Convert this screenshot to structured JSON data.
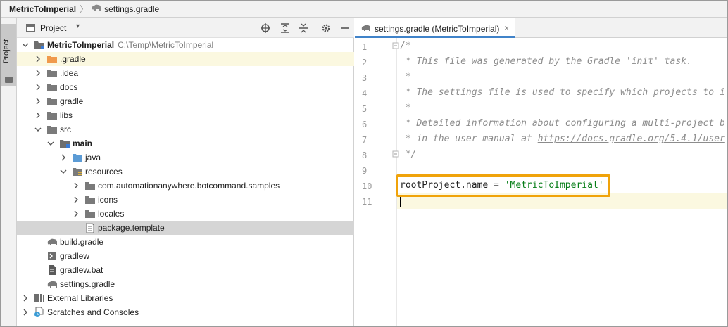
{
  "navbar": {
    "project_name": "MetricToImperial",
    "separator": "〉",
    "file_name": "settings.gradle"
  },
  "stripe": {
    "label": "Project"
  },
  "project_panel": {
    "title": "Project",
    "dropdown": "▾"
  },
  "tree": {
    "root_name": "MetricToImperial",
    "root_path": "C:\\Temp\\MetricToImperial",
    "items": [
      {
        "label": ".gradle"
      },
      {
        "label": ".idea"
      },
      {
        "label": "docs"
      },
      {
        "label": "gradle"
      },
      {
        "label": "libs"
      },
      {
        "label": "src"
      },
      {
        "label": "main"
      },
      {
        "label": "java"
      },
      {
        "label": "resources"
      },
      {
        "label": "com.automationanywhere.botcommand.samples"
      },
      {
        "label": "icons"
      },
      {
        "label": "locales"
      },
      {
        "label": "package.template"
      },
      {
        "label": "build.gradle"
      },
      {
        "label": "gradlew"
      },
      {
        "label": "gradlew.bat"
      },
      {
        "label": "settings.gradle"
      },
      {
        "label": "External Libraries"
      },
      {
        "label": "Scratches and Consoles"
      }
    ]
  },
  "editor": {
    "tab_label": "settings.gradle (MetricToImperial)",
    "tab_close": "×",
    "line_numbers": [
      "1",
      "2",
      "3",
      "4",
      "5",
      "6",
      "7",
      "8",
      "9",
      "10",
      "11"
    ],
    "lines": {
      "l1": "/*",
      "l2": " * This file was generated by the Gradle 'init' task.",
      "l3": " *",
      "l4": " * The settings file is used to specify which projects to i",
      "l5": " *",
      "l6": " * Detailed information about configuring a multi-project b",
      "l7_prefix": " * in the user manual at ",
      "l7_url": "https://docs.gradle.org/5.4.1/user",
      "l8": " */",
      "l10_prefix": "rootProject.name = ",
      "l10_str": "'MetricToImperial'"
    }
  },
  "colors": {
    "highlight_box": "#f0a30a",
    "tab_underline": "#4083c9",
    "selection": "#d5d5d5",
    "row_highlight": "#fbf8e0"
  }
}
